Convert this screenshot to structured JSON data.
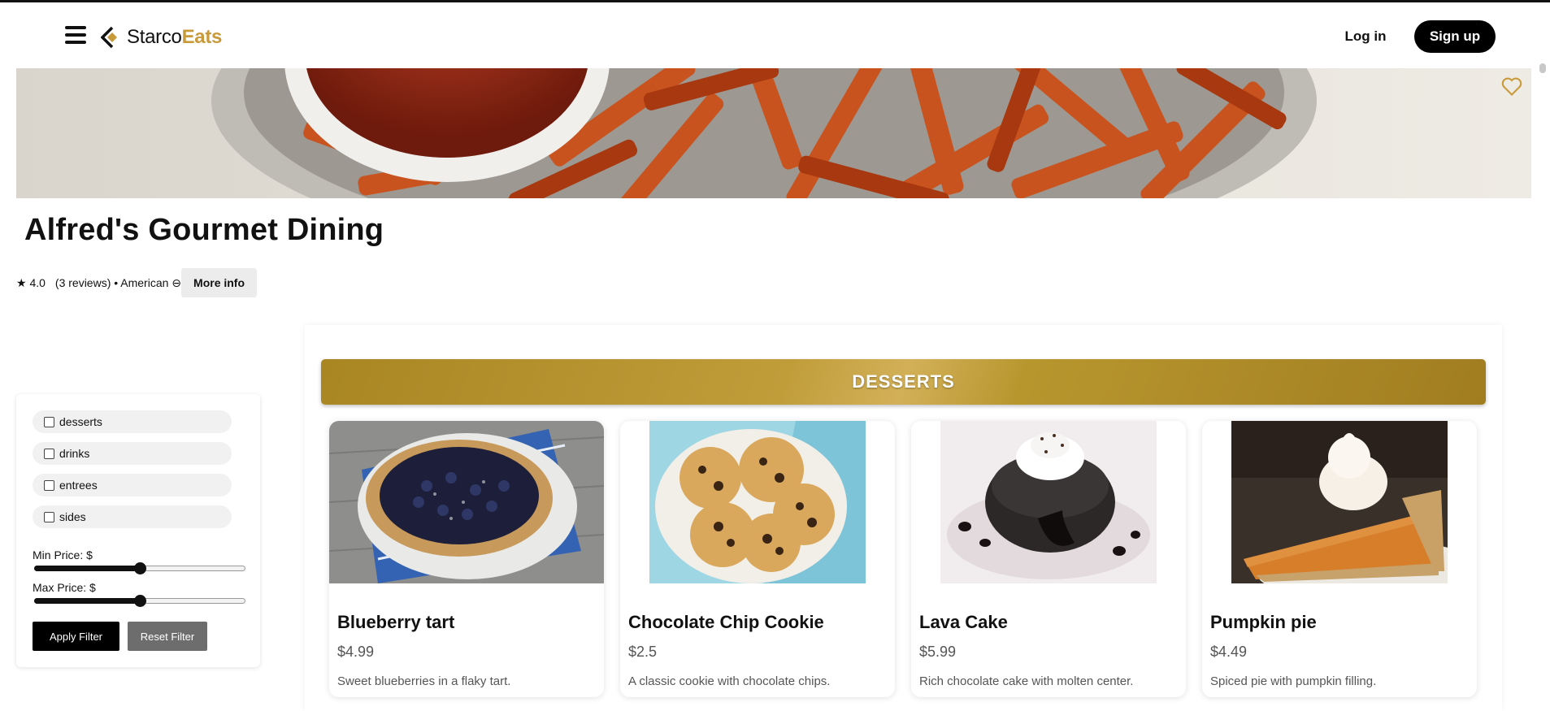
{
  "brand": {
    "name_part1": "Starco",
    "name_part2": "Eats",
    "accent": "#c99a3a"
  },
  "header": {
    "login_label": "Log in",
    "signup_label": "Sign up"
  },
  "restaurant": {
    "name": "Alfred's Gourmet Dining",
    "rating": "★ 4.0",
    "reviews": "(3 reviews) • American ⊖",
    "more_info_label": "More info"
  },
  "filters": {
    "options": [
      "desserts",
      "drinks",
      "entrees",
      "sides"
    ],
    "min_price_label": "Min Price: $",
    "max_price_label": "Max Price: $",
    "min_price_slider_position": 0.5,
    "max_price_slider_position": 0.5,
    "apply_label": "Apply Filter",
    "reset_label": "Reset Filter"
  },
  "menu": {
    "category": "DESSERTS",
    "items": [
      {
        "name": "Blueberry tart",
        "price": "$4.99",
        "desc": "Sweet blueberries in a flaky tart."
      },
      {
        "name": "Chocolate Chip Cookie",
        "price": "$2.5",
        "desc": "A classic cookie with chocolate chips."
      },
      {
        "name": "Lava Cake",
        "price": "$5.99",
        "desc": "Rich chocolate cake with molten center."
      },
      {
        "name": "Pumpkin pie",
        "price": "$4.49",
        "desc": "Spiced pie with pumpkin filling."
      }
    ]
  }
}
